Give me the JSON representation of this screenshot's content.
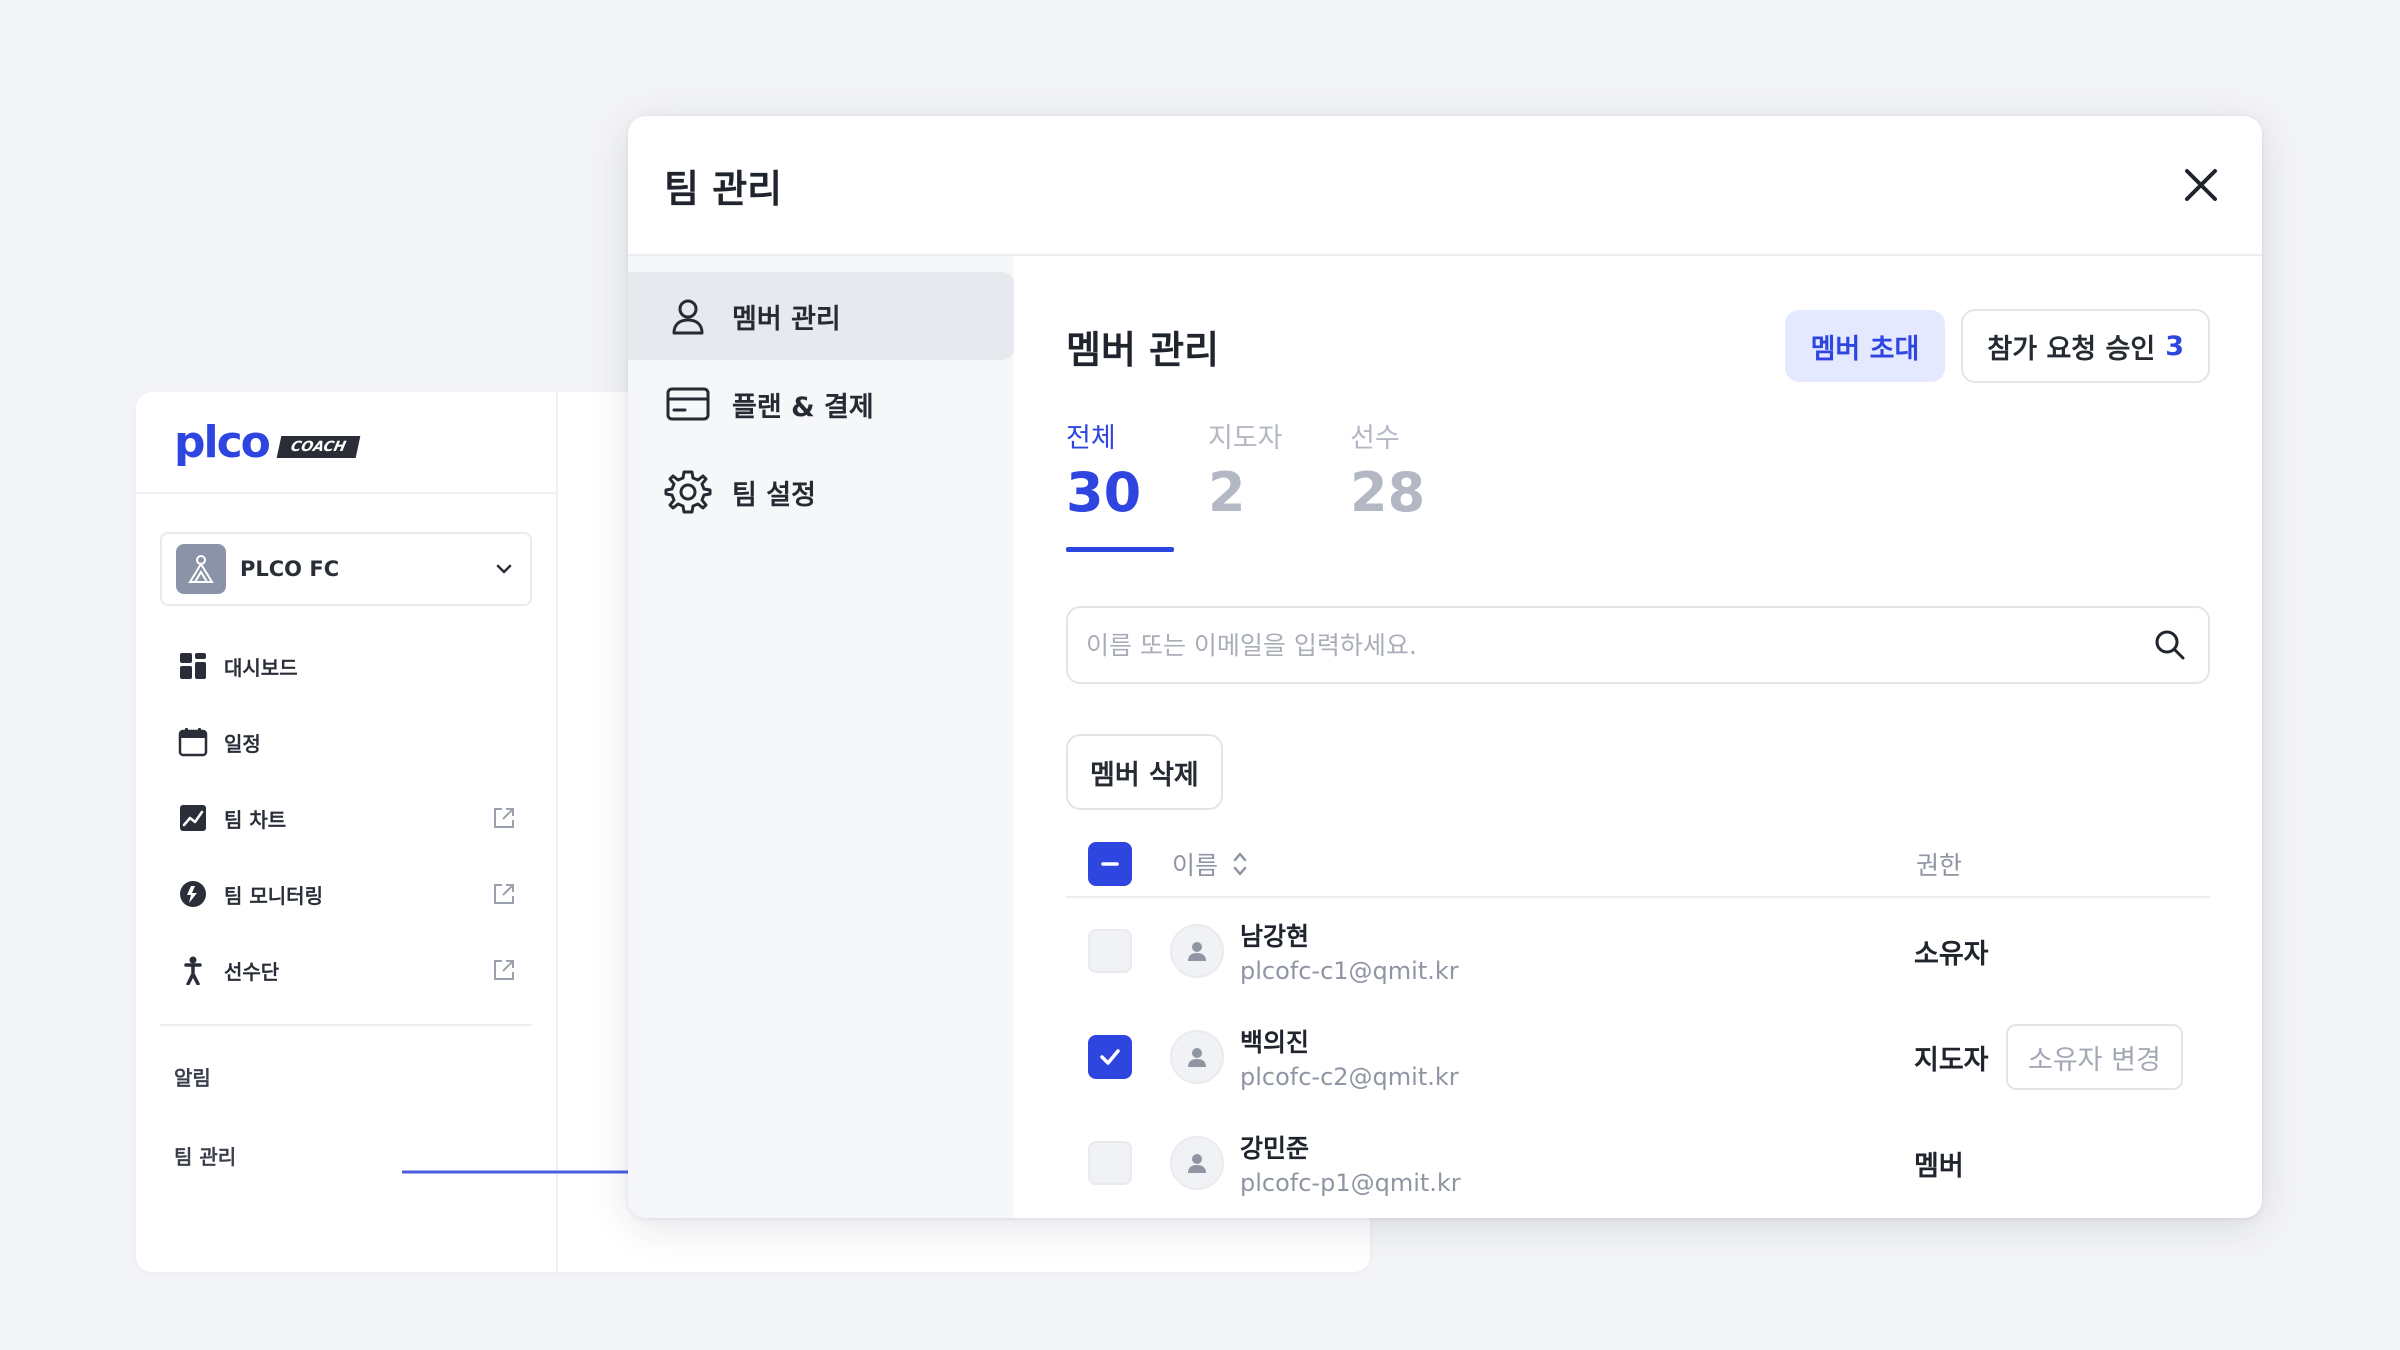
{
  "background_app": {
    "logo": "plco",
    "logo_badge": "COACH",
    "team_select": {
      "value": "PLCO FC"
    },
    "menu": [
      {
        "label": "대시보드",
        "icon": "dashboard-icon",
        "external": false
      },
      {
        "label": "일정",
        "icon": "calendar-icon",
        "external": false
      },
      {
        "label": "팀 차트",
        "icon": "chart-icon",
        "external": true
      },
      {
        "label": "팀 모니터링",
        "icon": "monitoring-icon",
        "external": true
      },
      {
        "label": "선수단",
        "icon": "player-icon",
        "external": true
      }
    ],
    "notifications_label": "알림",
    "team_manage_label": "팀 관리"
  },
  "modal": {
    "title": "팀 관리",
    "nav": [
      {
        "label": "멤버 관리",
        "icon": "user-icon",
        "active": true
      },
      {
        "label": "플랜 & 결제",
        "icon": "card-icon",
        "active": false
      },
      {
        "label": "팀 설정",
        "icon": "gear-icon",
        "active": false
      }
    ],
    "content": {
      "title": "멤버 관리",
      "invite_label": "멤버 초대",
      "requests_label": "참가 요청 승인",
      "requests_count": "3",
      "stats": [
        {
          "label": "전체",
          "value": "30",
          "active": true
        },
        {
          "label": "지도자",
          "value": "2",
          "active": false
        },
        {
          "label": "선수",
          "value": "28",
          "active": false
        }
      ],
      "search_placeholder": "이름 또는 이메일을 입력하세요.",
      "delete_label": "멤버 삭제",
      "table": {
        "col_name": "이름",
        "col_role": "권한",
        "rows": [
          {
            "name": "남강현",
            "email": "plcofc-c1@qmit.kr",
            "role": "소유자",
            "checked": false,
            "action": ""
          },
          {
            "name": "백의진",
            "email": "plcofc-c2@qmit.kr",
            "role": "지도자",
            "checked": true,
            "action": "소유자 변경"
          },
          {
            "name": "강민준",
            "email": "plcofc-p1@qmit.kr",
            "role": "멤버",
            "checked": false,
            "action": ""
          }
        ]
      }
    }
  },
  "colors": {
    "accent": "#2f45e0",
    "accent_light": "#e4e9ff",
    "muted": "#b3b8c4",
    "background": "#f3f4f7"
  }
}
